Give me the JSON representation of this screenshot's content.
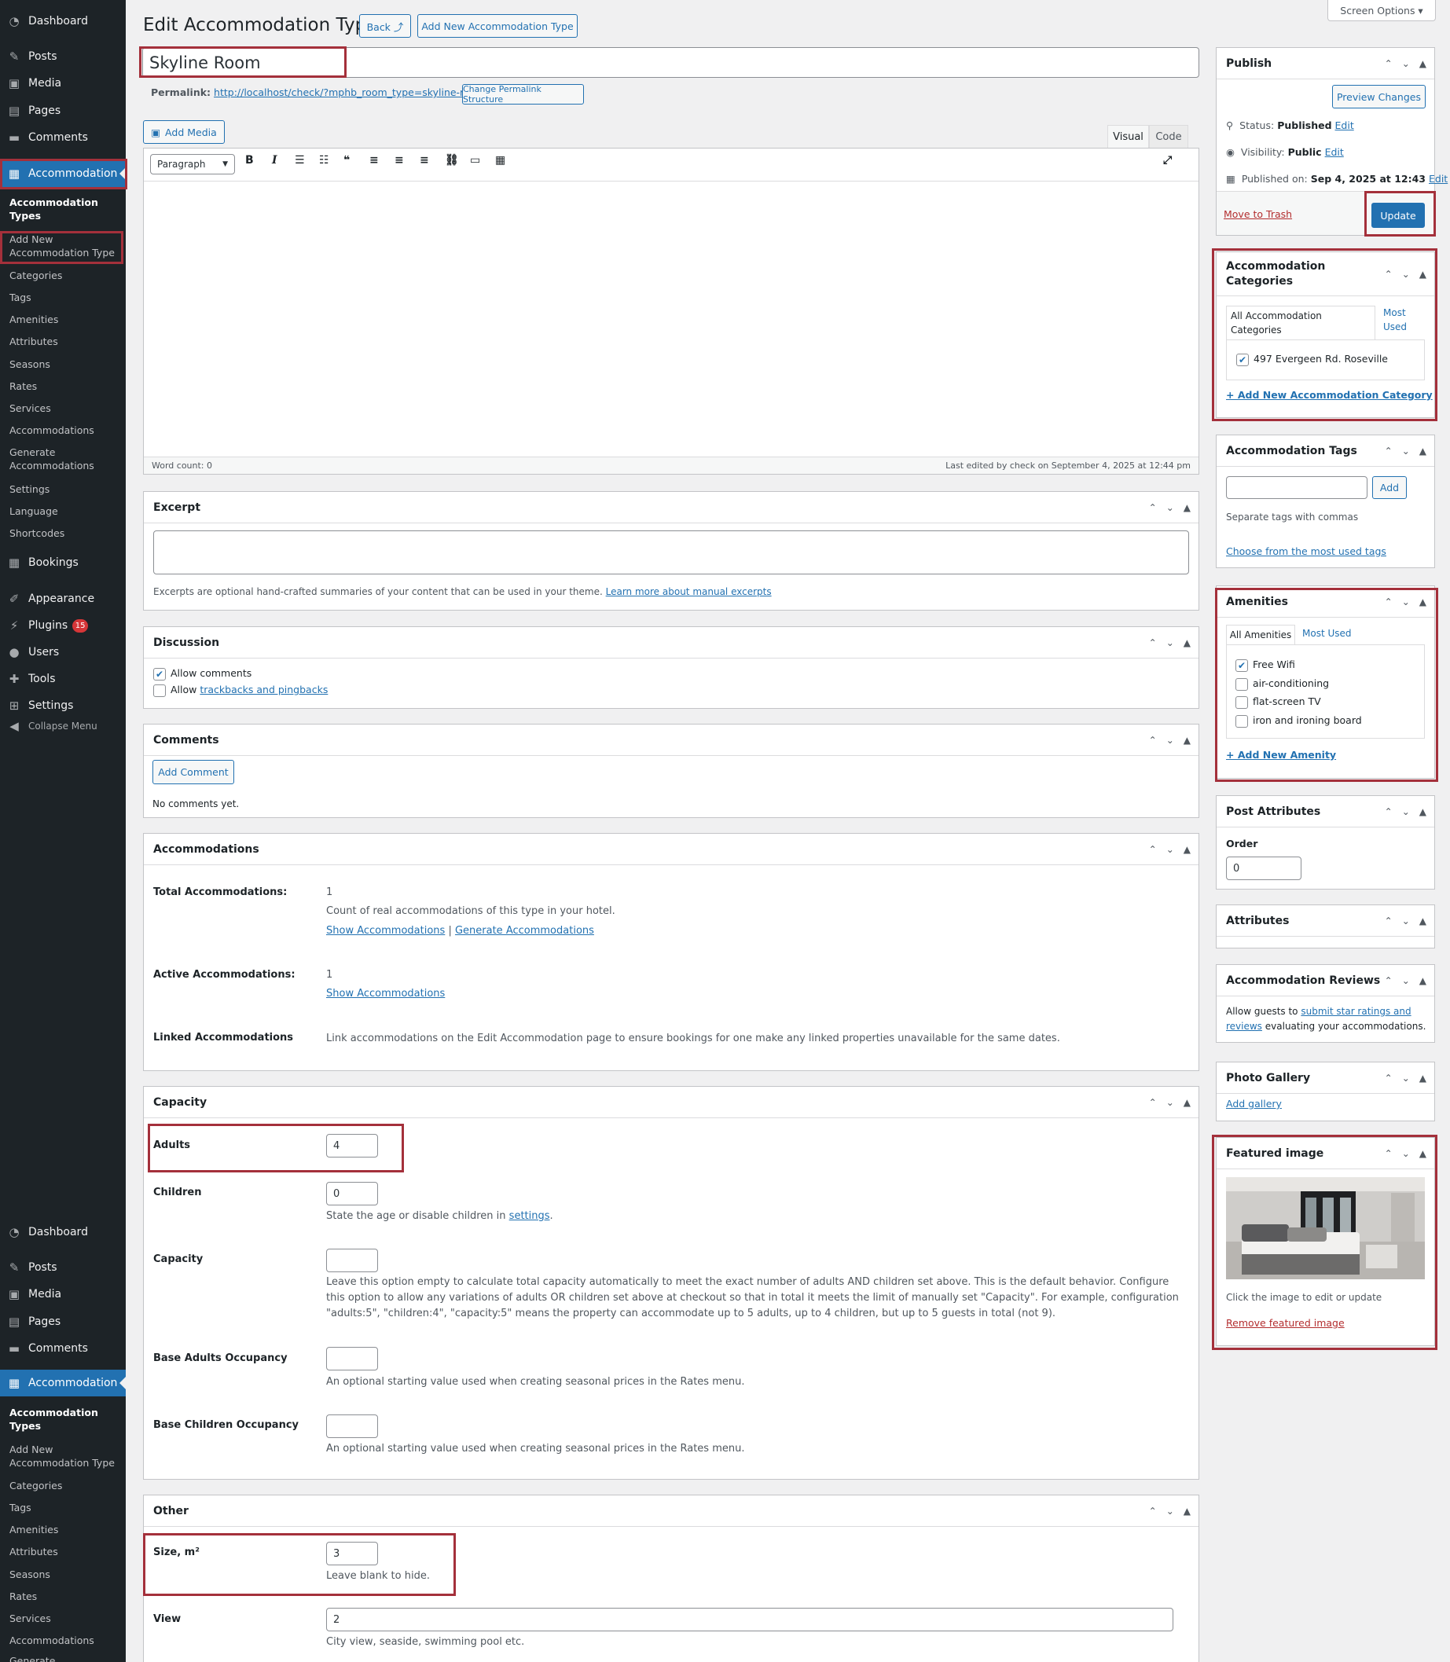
{
  "sidebar": {
    "top": {
      "dashboard": "Dashboard",
      "posts": "Posts",
      "media": "Media",
      "pages": "Pages",
      "comments": "Comments",
      "accommodation": "Accommodation",
      "bookings": "Bookings",
      "appearance": "Appearance",
      "plugins": "Plugins",
      "plugins_badge": "15",
      "users": "Users",
      "tools": "Tools",
      "settings": "Settings",
      "collapse": "Collapse Menu"
    },
    "submenu": [
      "Accommodation Types",
      "Add New Accommodation Type",
      "Categories",
      "Tags",
      "Amenities",
      "Attributes",
      "Seasons",
      "Rates",
      "Services",
      "Accommodations",
      "Generate Accommodations",
      "Settings",
      "Language",
      "Shortcodes"
    ],
    "repeat_submenu": [
      "Accommodation Types",
      "Add New Accommodation Type",
      "Categories",
      "Tags",
      "Amenities",
      "Attributes",
      "Seasons",
      "Rates",
      "Services",
      "Accommodations",
      "Generate"
    ]
  },
  "header": {
    "title": "Edit Accommodation Type",
    "back": "Back ⤴",
    "add_new": "Add New Accommodation Type",
    "screen_options": "Screen Options ▾"
  },
  "post": {
    "title": "Skyline Room",
    "permalink_label": "Permalink:",
    "permalink_url": "http://localhost/check/?mphb_room_type=skyline-room",
    "change_permalink": "Change Permalink Structure"
  },
  "editor": {
    "add_media": "Add Media",
    "tab_visual": "Visual",
    "tab_code": "Code",
    "format": "Paragraph",
    "word_count": "Word count: 0",
    "last_edited": "Last edited by check on September 4, 2025 at 12:44 pm"
  },
  "excerpt": {
    "title": "Excerpt",
    "help": "Excerpts are optional hand-crafted summaries of your content that can be used in your theme.",
    "link": "Learn more about manual excerpts"
  },
  "discussion": {
    "title": "Discussion",
    "allow_comments": "Allow comments",
    "allow": "Allow",
    "trackbacks": "trackbacks and pingbacks"
  },
  "comments": {
    "title": "Comments",
    "add_button": "Add Comment",
    "none": "No comments yet."
  },
  "accommodations": {
    "title": "Accommodations",
    "total_label": "Total Accommodations:",
    "total_value": "1",
    "total_help": "Count of real accommodations of this type in your hotel.",
    "show": "Show Accommodations",
    "sep": "|",
    "generate": "Generate Accommodations",
    "active_label": "Active Accommodations:",
    "active_value": "1",
    "linked_label": "Linked Accommodations",
    "linked_help": "Link accommodations on the Edit Accommodation page to ensure bookings for one make any linked properties unavailable for the same dates."
  },
  "capacity": {
    "title": "Capacity",
    "adults_label": "Adults",
    "adults_value": "4",
    "children_label": "Children",
    "children_value": "0",
    "children_help": "State the age or disable children in",
    "settings_link": "settings",
    "capacity_label": "Capacity",
    "capacity_help": "Leave this option empty to calculate total capacity automatically to meet the exact number of adults AND children set above. This is the default behavior. Configure this option to allow any variations of adults OR children set above at checkout so that in total it meets the limit of manually set \"Capacity\". For example, configuration \"adults:5\", \"children:4\", \"capacity:5\" means the property can accommodate up to 5 adults, up to 4 children, but up to 5 guests in total (not 9).",
    "base_adults_label": "Base Adults Occupancy",
    "base_adults_help": "An optional starting value used when creating seasonal prices in the Rates menu.",
    "base_children_label": "Base Children Occupancy",
    "base_children_help": "An optional starting value used when creating seasonal prices in the Rates menu."
  },
  "other": {
    "title": "Other",
    "size_label": "Size, m²",
    "size_value": "3",
    "size_help": "Leave blank to hide.",
    "view_label": "View",
    "view_value": "2",
    "view_help": "City view, seaside, swimming pool etc."
  },
  "publish": {
    "title": "Publish",
    "preview": "Preview Changes",
    "status_label": "Status:",
    "status_value": "Published",
    "edit": "Edit",
    "visibility_label": "Visibility:",
    "visibility_value": "Public",
    "published_label": "Published on:",
    "published_value": "Sep 4, 2025 at 12:43",
    "trash": "Move to Trash",
    "update": "Update"
  },
  "categories": {
    "title": "Accommodation Categories",
    "tab_all": "All Accommodation Categories",
    "tab_most": "Most Used",
    "item": "497 Evergeen Rd. Roseville",
    "add": "+ Add New Accommodation Category"
  },
  "tags": {
    "title": "Accommodation Tags",
    "add": "Add",
    "help": "Separate tags with commas",
    "choose": "Choose from the most used tags"
  },
  "amenities": {
    "title": "Amenities",
    "tab_all": "All Amenities",
    "tab_most": "Most Used",
    "items": [
      "Free Wifi",
      "air-conditioning",
      "flat-screen TV",
      "iron and ironing board"
    ],
    "add": "+ Add New Amenity"
  },
  "post_attributes": {
    "title": "Post Attributes",
    "order_label": "Order",
    "order_value": "0"
  },
  "attributes": {
    "title": "Attributes"
  },
  "reviews": {
    "title": "Accommodation Reviews",
    "pre": "Allow guests to",
    "link": "submit star ratings and reviews",
    "post": "evaluating your accommodations."
  },
  "gallery": {
    "title": "Photo Gallery",
    "add": "Add gallery"
  },
  "featured": {
    "title": "Featured image",
    "help": "Click the image to edit or update",
    "remove": "Remove featured image"
  }
}
